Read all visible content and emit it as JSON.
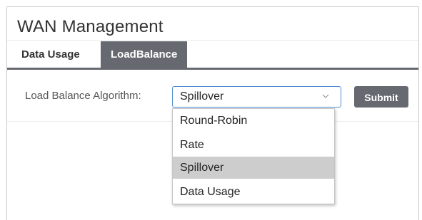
{
  "page": {
    "title": "WAN Management"
  },
  "tabs": [
    {
      "label": "Data Usage",
      "active": false
    },
    {
      "label": "LoadBalance",
      "active": true
    }
  ],
  "form": {
    "algorithm_label": "Load Balance Algorithm:",
    "algorithm_value": "Spillover",
    "submit_label": "Submit"
  },
  "dropdown": {
    "options": [
      "Round-Robin",
      "Rate",
      "Spillover",
      "Data Usage"
    ],
    "highlighted": "Spillover"
  },
  "icons": {
    "select_arrow": "chevron-down-icon"
  },
  "colors": {
    "tab_active_bg": "#666a70",
    "select_border": "#4f8dd1",
    "option_highlight": "#cdcdcd"
  }
}
